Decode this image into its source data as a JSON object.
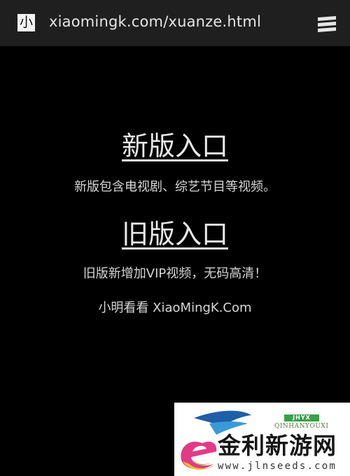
{
  "browser": {
    "site_icon_char": "小",
    "url": "xiaomingk.com/xuanze.html",
    "menu_icon": "menu-icon"
  },
  "main": {
    "new_entry_label": "新版入口",
    "new_entry_desc": "新版包含电视剧、综艺节目等视频。",
    "old_entry_label": "旧版入口",
    "old_entry_desc": "旧版新增加VIP视频，无码高清！",
    "site_credit": "小明看看 XiaoMingK.Com"
  },
  "watermark": {
    "badge": "JHYX",
    "pinyin": "QINHANYOUXI",
    "name": "金利新游网",
    "url": "www.jlnseeds.com"
  },
  "colors": {
    "background": "#000000",
    "topbar": "#1f1f1f",
    "text": "#e9e9e9"
  }
}
